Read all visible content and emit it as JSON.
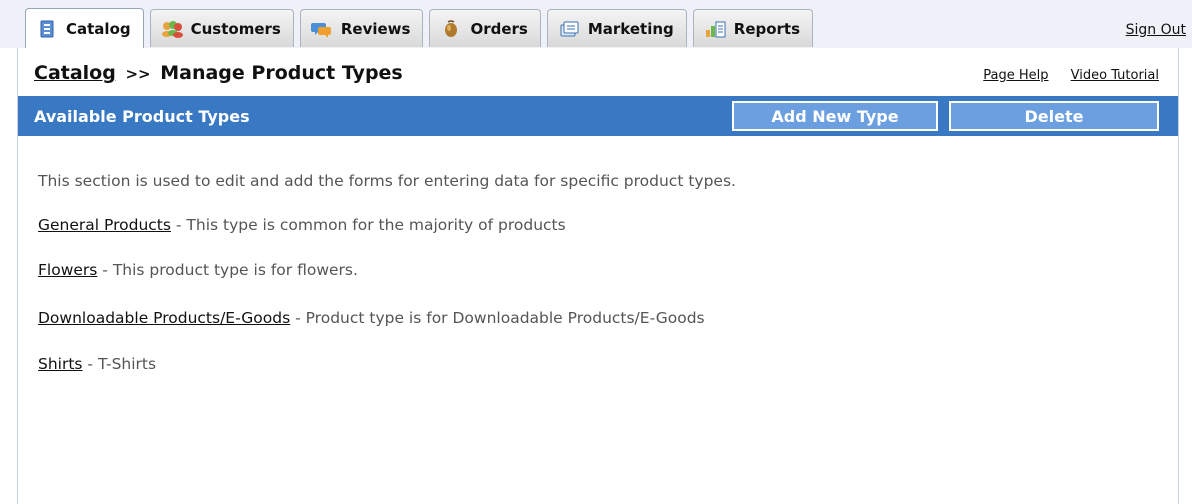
{
  "tabs": [
    {
      "label": "Catalog",
      "icon": "catalog-icon",
      "active": true
    },
    {
      "label": "Customers",
      "icon": "customers-icon",
      "active": false
    },
    {
      "label": "Reviews",
      "icon": "reviews-icon",
      "active": false
    },
    {
      "label": "Orders",
      "icon": "orders-icon",
      "active": false
    },
    {
      "label": "Marketing",
      "icon": "marketing-icon",
      "active": false
    },
    {
      "label": "Reports",
      "icon": "reports-icon",
      "active": false
    }
  ],
  "sign_out": "Sign Out",
  "breadcrumb": {
    "parent": "Catalog",
    "separator": ">>",
    "current": "Manage Product Types"
  },
  "help_links": {
    "page_help": "Page Help",
    "video_tutorial": "Video Tutorial"
  },
  "section": {
    "title": "Available Product Types",
    "add_button": "Add New Type",
    "delete_button": "Delete"
  },
  "intro": "This section is used to edit and add the forms for entering data for specific product types.",
  "product_types": [
    {
      "name": "General Products",
      "description": " - This type is common for the majority of products"
    },
    {
      "name": "Flowers",
      "description": " - This product type is for flowers."
    },
    {
      "name": "Downloadable Products/E-Goods",
      "description": " - Product type is for Downloadable Products/E-Goods"
    },
    {
      "name": "Shirts",
      "description": " - T-Shirts"
    }
  ],
  "colors": {
    "header_bar": "#3979c4",
    "button_bg": "#6b9fe0",
    "tab_strip": "#eef2f8",
    "body_text": "#555555"
  }
}
